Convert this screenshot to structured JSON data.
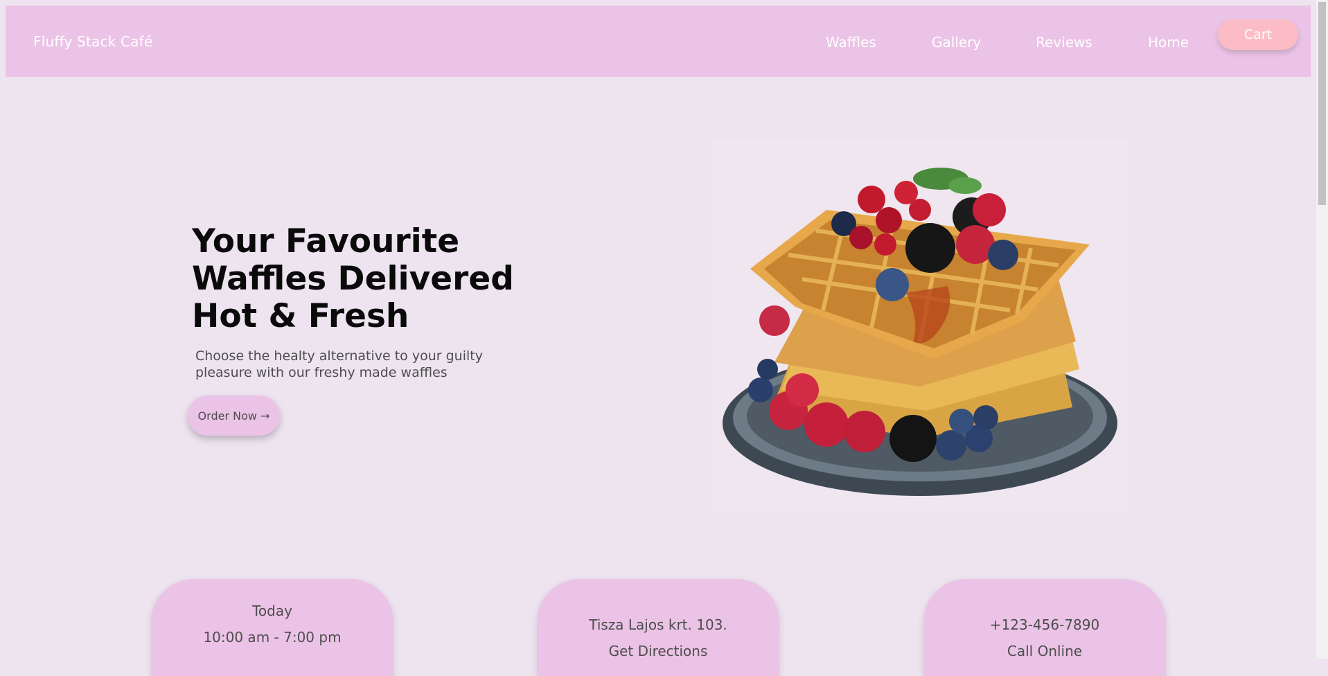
{
  "header": {
    "brand": "Fluffy Stack Café",
    "nav": [
      "Waffles",
      "Gallery",
      "Reviews",
      "Home"
    ],
    "cart_label": "Cart"
  },
  "hero": {
    "title_lines": [
      "Your Favourite",
      "Waffles Delivered",
      "Hot & Fresh"
    ],
    "subtitle_lines": [
      "Choose the healty alternative to your guilty",
      "pleasure with our freshy made waffles"
    ],
    "order_label": "Order Now →"
  },
  "info_cards": [
    {
      "line1": "Today",
      "line2": "10:00 am - 7:00 pm"
    },
    {
      "line1": "Tisza Lajos krt. 103.",
      "line2": "Get Directions"
    },
    {
      "line1": "+123-456-7890",
      "line2": "Call Online"
    }
  ],
  "colors": {
    "background": "#ede4f0",
    "navbar": "#ebc3e6",
    "cart_button": "#fcbcc6",
    "card": "#ebc3e6"
  },
  "icons": {
    "order_arrow": "arrow-right-icon"
  }
}
